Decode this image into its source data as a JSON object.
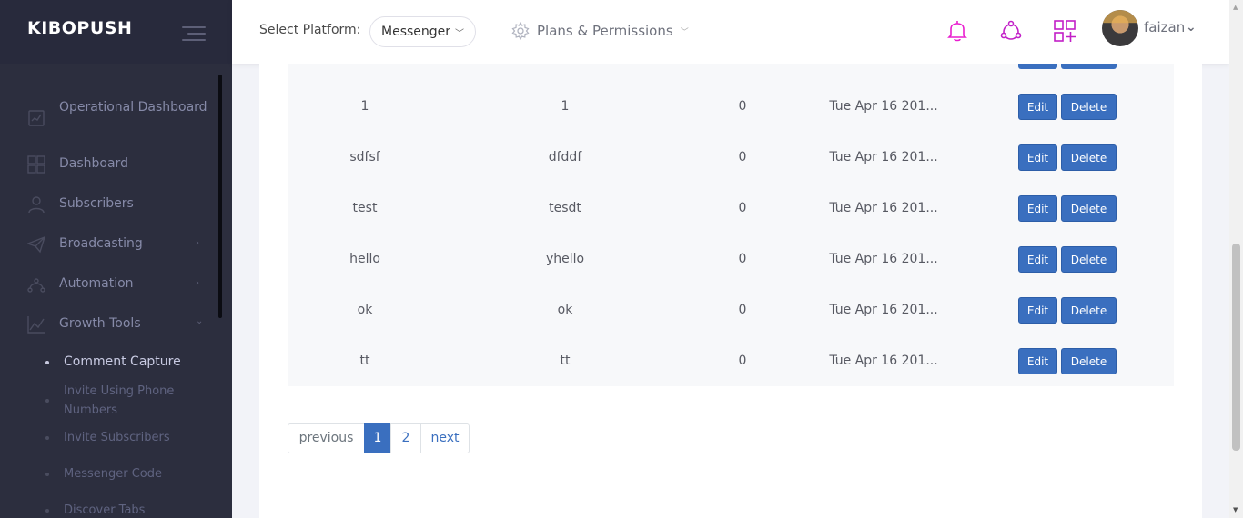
{
  "app": {
    "brand": "KIBOPUSH"
  },
  "sidebar": {
    "items": [
      {
        "label": "Operational Dashboard",
        "icon": "operational-dashboard-icon"
      },
      {
        "label": "Dashboard",
        "icon": "dashboard-grid-icon"
      },
      {
        "label": "Subscribers",
        "icon": "user-icon"
      },
      {
        "label": "Broadcasting",
        "icon": "paper-plane-icon",
        "arrow": "›"
      },
      {
        "label": "Automation",
        "icon": "robot-icon",
        "arrow": "›"
      },
      {
        "label": "Growth Tools",
        "icon": "line-chart-icon",
        "arrow": "⌄"
      }
    ],
    "subitems": [
      {
        "label": "Comment Capture",
        "active": true
      },
      {
        "label": "Invite Using Phone Numbers"
      },
      {
        "label": "Invite Subscribers"
      },
      {
        "label": "Messenger Code"
      },
      {
        "label": "Discover Tabs"
      }
    ]
  },
  "header": {
    "select_label": "Select Platform:",
    "platform": "Messenger",
    "plans_label": "Plans & Permissions",
    "username": "faizan",
    "colors": {
      "notification_icon": "#e91ecf",
      "accent": "#c21fc7"
    }
  },
  "table": {
    "rows": [
      {
        "c1": "1",
        "c2": "1",
        "c3": "0",
        "c4": "Tue Apr 16 201...",
        "edit": "Edit",
        "delete": "Delete"
      },
      {
        "c1": "sdfsf",
        "c2": "dfddf",
        "c3": "0",
        "c4": "Tue Apr 16 201...",
        "edit": "Edit",
        "delete": "Delete"
      },
      {
        "c1": "test",
        "c2": "tesdt",
        "c3": "0",
        "c4": "Tue Apr 16 201...",
        "edit": "Edit",
        "delete": "Delete"
      },
      {
        "c1": "hello",
        "c2": "yhello",
        "c3": "0",
        "c4": "Tue Apr 16 201...",
        "edit": "Edit",
        "delete": "Delete"
      },
      {
        "c1": "ok",
        "c2": "ok",
        "c3": "0",
        "c4": "Tue Apr 16 201...",
        "edit": "Edit",
        "delete": "Delete"
      },
      {
        "c1": "tt",
        "c2": "tt",
        "c3": "0",
        "c4": "Tue Apr 16 201...",
        "edit": "Edit",
        "delete": "Delete"
      }
    ]
  },
  "pagination": {
    "previous": "previous",
    "pages": [
      "1",
      "2"
    ],
    "current": "1",
    "next": "next"
  },
  "colors": {
    "primary_button": "#3a6fbf",
    "sidebar_bg": "#2c2e3e"
  }
}
